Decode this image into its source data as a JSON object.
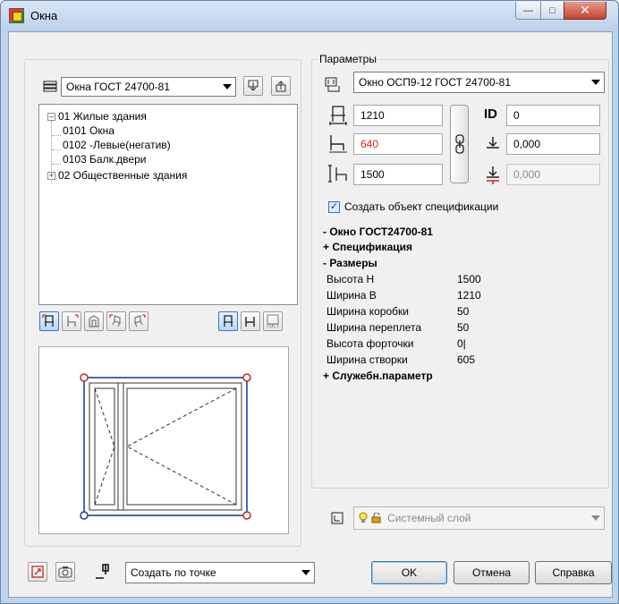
{
  "window": {
    "title": "Окна"
  },
  "left": {
    "catalog_select": "Окна ГОСТ 24700-81",
    "tree": [
      {
        "label": "01 Жилые здания",
        "expanded": true,
        "level": 0
      },
      {
        "label": "0101 Окна",
        "level": 1
      },
      {
        "label": "0102  -Левые(негатив)",
        "level": 1
      },
      {
        "label": "0103 Балк.двери",
        "level": 1
      },
      {
        "label": "02 Общественные здания",
        "expanded": false,
        "level": 0
      }
    ]
  },
  "params": {
    "group_label": "Параметры",
    "type_select": "Окно ОСП9-12 ГОСТ 24700-81",
    "width": "1210",
    "depth": "640",
    "height": "1500",
    "id_label": "ID",
    "id_value": "0",
    "elevation": "0,000",
    "elevation2": "0,000",
    "spec_checkbox_label": "Создать объект спецификации",
    "spec_checked": true
  },
  "properties": {
    "h1": "- Окно ГОСТ24700-81",
    "h2": "+ Спецификация",
    "h3": "- Размеры",
    "rows": [
      {
        "key": "Высота H",
        "value": "1500"
      },
      {
        "key": "Ширина B",
        "value": "1210"
      },
      {
        "key": "Ширина коробки",
        "value": "50"
      },
      {
        "key": "Ширина переплета",
        "value": "50"
      },
      {
        "key": "Высота форточки",
        "value": "0|"
      },
      {
        "key": "Ширина створки",
        "value": "605"
      }
    ],
    "h4": "+ Служебн.параметр"
  },
  "layer": {
    "label": "Системный слой"
  },
  "bottom": {
    "create_select": "Создать по точке",
    "ok": "OK",
    "cancel": "Отмена",
    "help": "Справка"
  },
  "colors": {
    "accent": "#3b74c9",
    "red_value": "#dd2222",
    "frame_blue": "#1f3fa8",
    "marker_red": "#c0282b"
  }
}
